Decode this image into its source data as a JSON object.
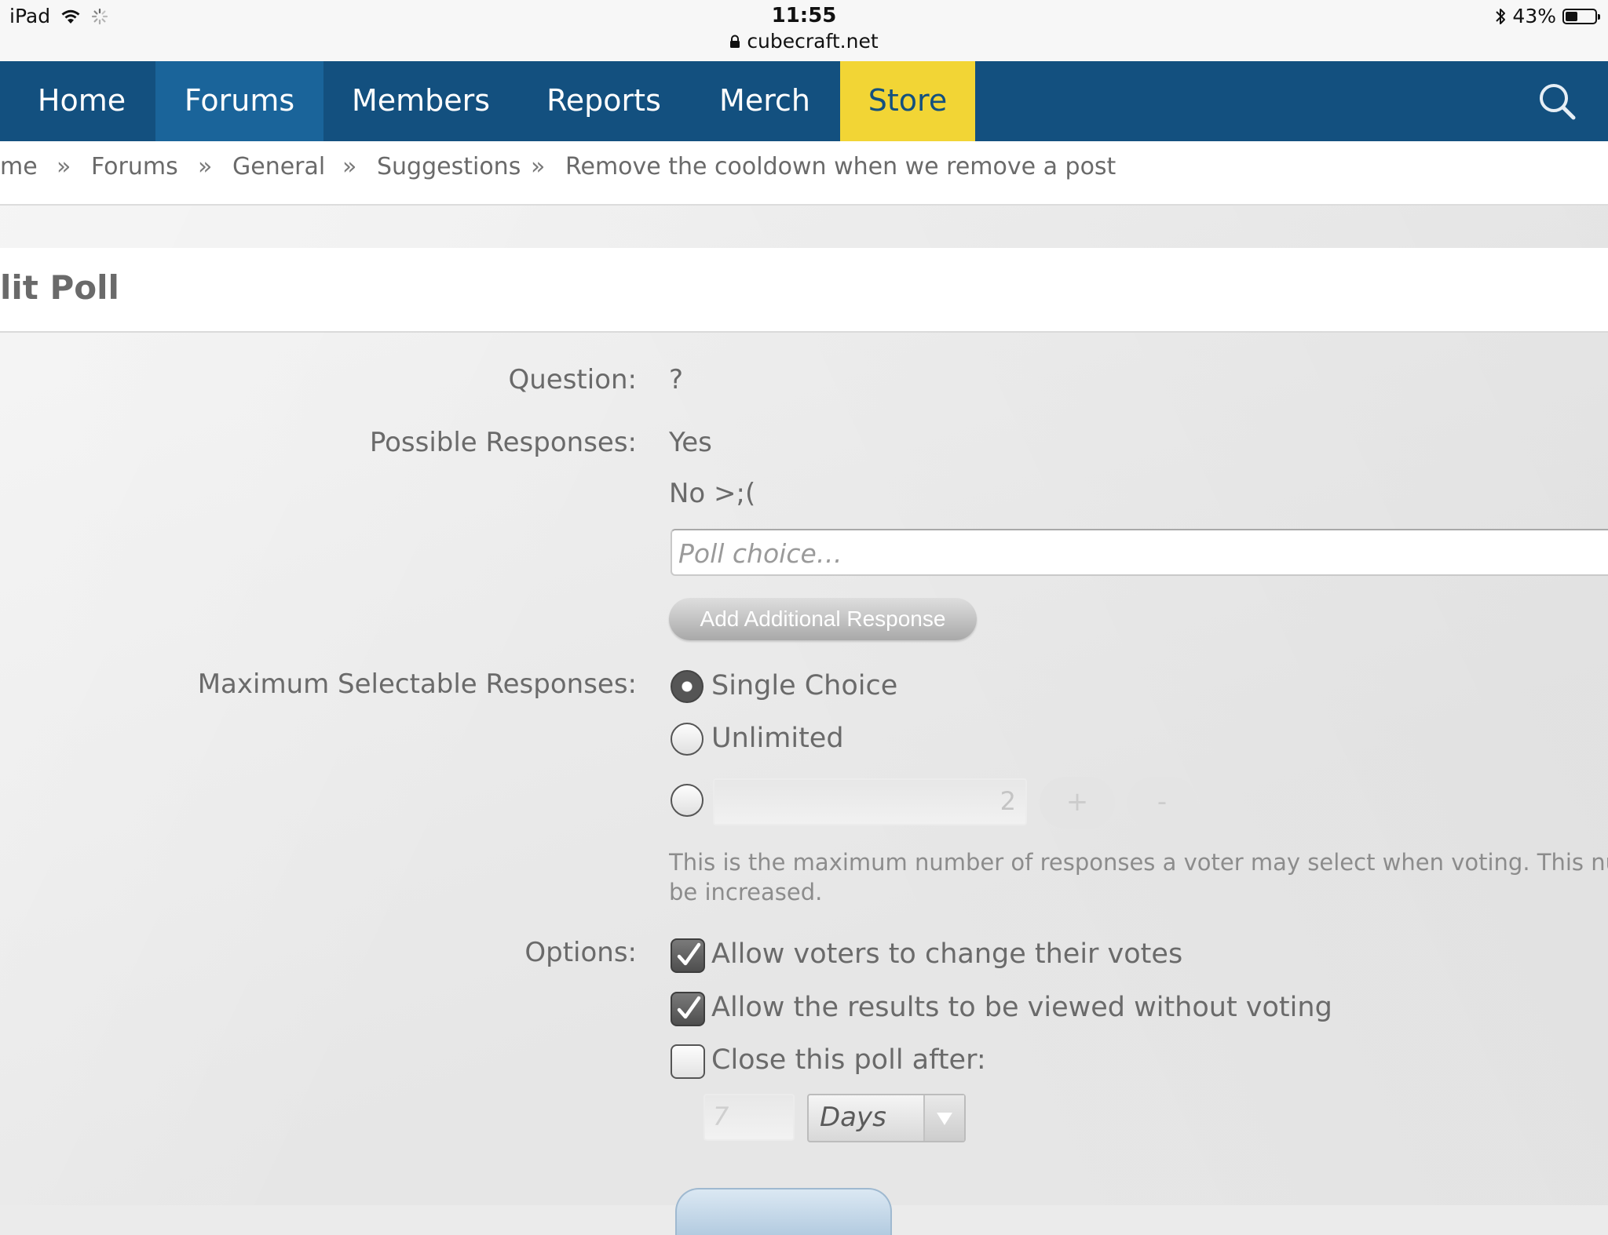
{
  "status_bar": {
    "device": "iPad",
    "time": "11:55",
    "url": "cubecraft.net",
    "battery": "43%",
    "battery_level": 0.43
  },
  "nav": {
    "items": [
      {
        "label": "Home"
      },
      {
        "label": "Forums"
      },
      {
        "label": "Members"
      },
      {
        "label": "Reports"
      },
      {
        "label": "Merch"
      },
      {
        "label": "Store"
      }
    ],
    "store_color": "#f2d535",
    "bar_color": "#13507f",
    "active_color": "#1a649a"
  },
  "breadcrumb": {
    "items": [
      {
        "label": "me"
      },
      {
        "label": "Forums"
      },
      {
        "label": "General"
      },
      {
        "label": "Suggestions"
      },
      {
        "label": "Remove the cooldown when we remove a post"
      }
    ],
    "separator": "»"
  },
  "page": {
    "title": "lit Poll"
  },
  "form": {
    "question_label": "Question:",
    "question_value": "?",
    "responses_label": "Possible Responses:",
    "responses": [
      "Yes",
      "No >;("
    ],
    "poll_choice_placeholder": "Poll choice…",
    "add_response_label": "Add Additional Response",
    "max_label": "Maximum Selectable Responses:",
    "max_options": {
      "single": "Single Choice",
      "unlimited": "Unlimited",
      "selected": "single"
    },
    "max_number_value": "2",
    "plus_label": "+",
    "minus_label": "-",
    "help_line1": "This is the maximum number of responses a voter may select when voting. This numbe",
    "help_line2": "be increased.",
    "options_label": "Options:",
    "options": {
      "change_votes": {
        "label": "Allow voters to change their votes",
        "checked": true
      },
      "view_results": {
        "label": "Allow the results to be viewed without voting",
        "checked": true
      },
      "close_after": {
        "label": "Close this poll after:",
        "checked": false
      }
    },
    "close_after_value": "7",
    "close_after_unit": "Days"
  }
}
